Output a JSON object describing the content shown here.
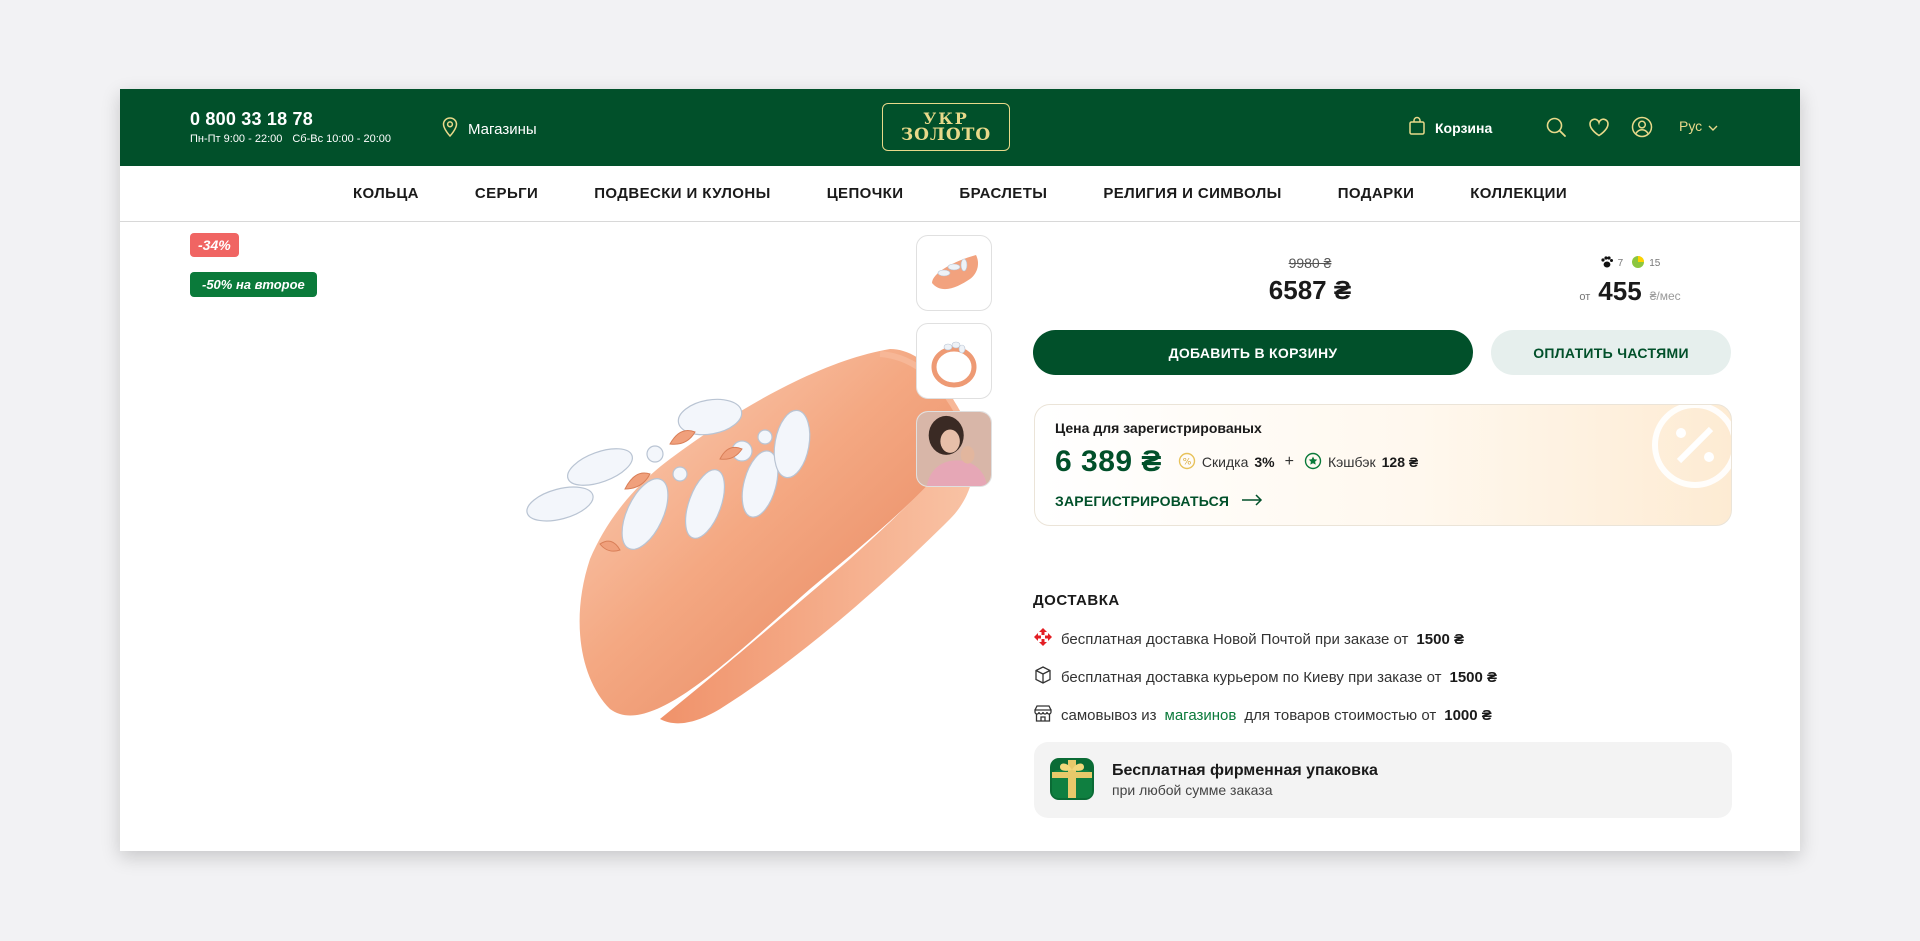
{
  "header": {
    "phone": "0 800 33 18 78",
    "hours_weekdays": "Пн-Пт 9:00 - 22:00",
    "hours_weekend": "Сб-Вс 10:00 - 20:00",
    "stores_label": "Магазины",
    "logo_line1": "УКР",
    "logo_line2": "ЗОЛОТО",
    "cart_label": "Корзина",
    "lang_label": "Рус"
  },
  "nav": {
    "items": [
      "КОЛЬЦА",
      "СЕРЬГИ",
      "ПОДВЕСКИ И КУЛОНЫ",
      "ЦЕПОЧКИ",
      "БРАСЛЕТЫ",
      "РЕЛИГИЯ И СИМВОЛЫ",
      "ПОДАРКИ",
      "КОЛЛЕКЦИИ"
    ]
  },
  "badges": {
    "sale": "-34%",
    "second": "-50% на второе"
  },
  "price": {
    "old": "9980 ₴",
    "current": "6587 ₴"
  },
  "parts": {
    "count_a": "7",
    "count_b": "15",
    "from_label": "от",
    "amount": "455",
    "unit": "₴/мес"
  },
  "buttons": {
    "add_to_cart": "ДОБАВИТЬ В КОРЗИНУ",
    "pay_parts": "ОПЛАТИТЬ ЧАСТЯМИ"
  },
  "registered": {
    "title": "Цена для зарегистрированых",
    "price": "6 389 ₴",
    "discount_label": "Скидка",
    "discount_value": "3%",
    "plus": "+",
    "cashback_label": "Кэшбэк",
    "cashback_value": "128 ₴",
    "register_link": "ЗАРЕГИСТРИРОВАТЬСЯ"
  },
  "delivery": {
    "title": "ДОСТАВКА",
    "row1_text": "бесплатная доставка Новой Почтой при заказе от",
    "row1_value": "1500 ₴",
    "row2_text": "бесплатная доставка курьером по Киеву при заказе от",
    "row2_value": "1500 ₴",
    "row3_pre": "самовывоз из",
    "row3_link": "магазинов",
    "row3_post": "для товаров стоимостью от",
    "row3_value": "1000 ₴"
  },
  "gift": {
    "title": "Бесплатная фирменная упаковка",
    "subtitle": "при любой сумме заказа"
  },
  "colors": {
    "brand_green": "#01502a",
    "gold": "#e8d98a",
    "sale_red": "#f06563",
    "badge_green": "#0a7a3a"
  },
  "icons": {
    "stores": "map-pin-icon",
    "cart": "shopping-bag-icon",
    "search": "search-icon",
    "favorites": "heart-icon",
    "account": "user-icon",
    "lang": "chevron-down-icon"
  }
}
